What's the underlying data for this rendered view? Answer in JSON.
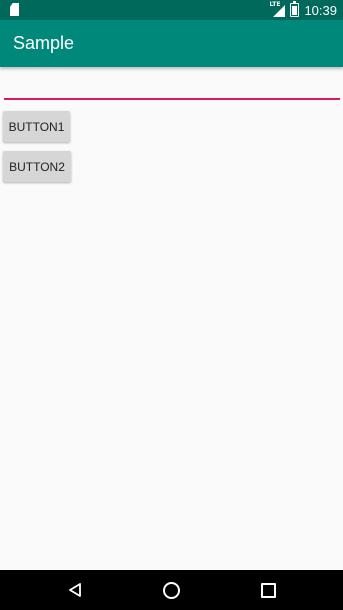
{
  "status_bar": {
    "network_label": "LTE",
    "time": "10:39",
    "icons": [
      "sd-card-icon",
      "lte-signal-icon",
      "battery-icon"
    ]
  },
  "app_bar": {
    "title": "Sample"
  },
  "input": {
    "value": "",
    "placeholder": ""
  },
  "buttons": {
    "button1_label": "BUTTON1",
    "button2_label": "BUTTON2"
  },
  "nav_bar": {
    "icons": [
      "back-icon",
      "home-icon",
      "recents-icon"
    ]
  },
  "colors": {
    "status_bar": "#00695C",
    "app_bar": "#00897B",
    "accent": "#D81B60",
    "background": "#FAFAFA",
    "button": "#D6D6D6"
  }
}
